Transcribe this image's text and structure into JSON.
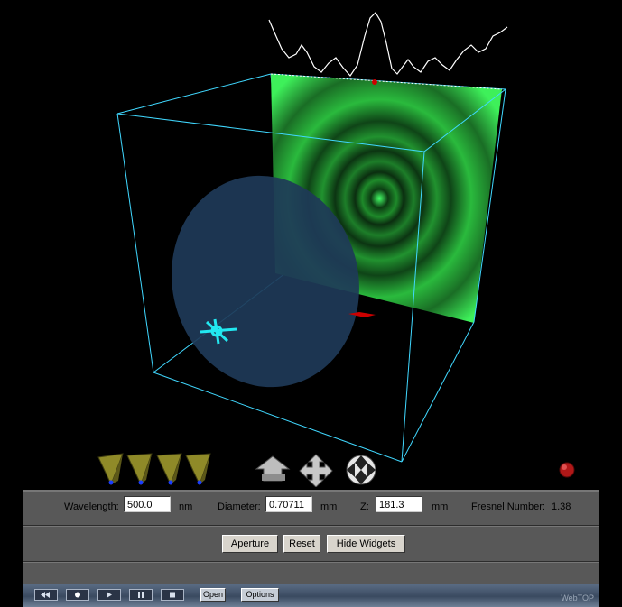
{
  "scene": {
    "colors": {
      "box": "#40d8ff",
      "pattern": "#33ff55",
      "aperture": "#1e3a58",
      "trace": "#ffffff",
      "marker": "#cc0000"
    }
  },
  "widgets": {
    "yellow_cones": [
      "cone-1",
      "cone-2",
      "cone-3",
      "cone-4"
    ],
    "tools": [
      "translate-up-icon",
      "translate-cross-icon",
      "rotate-sphere-icon"
    ]
  },
  "controls": {
    "wavelength_label": "Wavelength:",
    "wavelength_value": "500.0",
    "wavelength_unit": "nm",
    "diameter_label": "Diameter:",
    "diameter_value": "0.70711",
    "diameter_unit": "mm",
    "z_label": "Z:",
    "z_value": "181.3",
    "z_unit": "mm",
    "fresnel_label": "Fresnel Number:",
    "fresnel_value": "1.38",
    "aperture_button": "Aperture",
    "reset_button": "Reset",
    "hide_widgets_button": "Hide Widgets"
  },
  "player": {
    "open_label": "Open",
    "options_label": "Options",
    "brand": "WebTOP"
  }
}
